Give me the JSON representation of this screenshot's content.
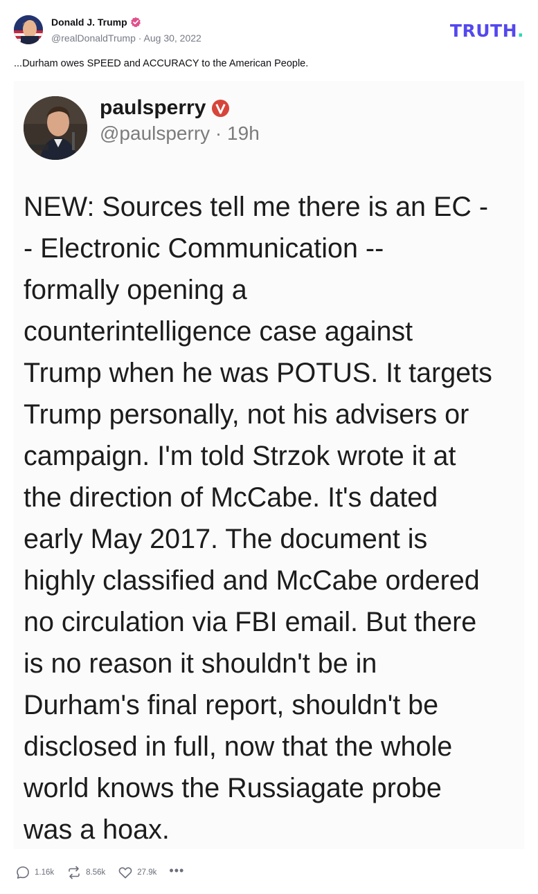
{
  "post": {
    "author_name": "Donald J. Trump",
    "author_handle": "@realDonaldTrump",
    "separator": " · ",
    "date": "Aug 30, 2022",
    "text": "...Durham owes SPEED and ACCURACY to the American People."
  },
  "brand": {
    "logo_text": "TRUTH",
    "logo_dot": ".",
    "logo_color": "#5448ee",
    "dot_color": "#2ad9b3"
  },
  "embedded": {
    "username": "paulsperry",
    "handle": "@paulsperry",
    "separator": " · ",
    "time": "19h",
    "lines": [
      "NEW: Sources tell me there is an EC -",
      "- Electronic Communication --",
      "formally opening a",
      "counterintelligence case against",
      "Trump when he was POTUS. It targets",
      "Trump personally, not his advisers or",
      "campaign. I'm told Strzok wrote it at",
      "the direction of McCabe. It's dated",
      "early May 2017. The document is",
      "highly classified and McCabe ordered",
      "no circulation via FBI email. But there",
      "is no reason it shouldn't be in",
      "Durham's final report, shouldn't be",
      "disclosed in full, now that the whole",
      "world knows the Russiagate probe",
      "was a hoax."
    ]
  },
  "actions": {
    "replies": "1.16k",
    "retruths": "8.56k",
    "likes": "27.9k",
    "more": "•••"
  }
}
